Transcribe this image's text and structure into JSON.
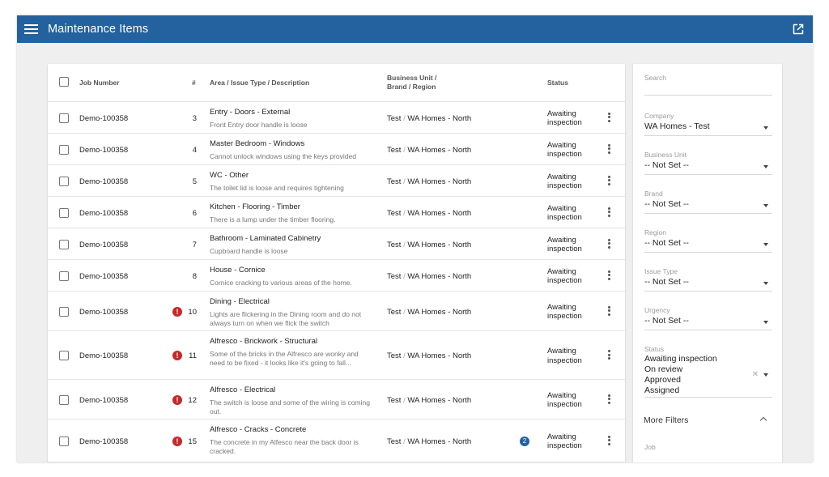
{
  "header": {
    "title": "Maintenance Items",
    "menu_icon": "menu-icon",
    "open_icon": "open-in-new-icon"
  },
  "colors": {
    "brand": "#23629e",
    "alert": "#c62828"
  },
  "table": {
    "columns": {
      "job": "Job Number",
      "num": "#",
      "desc": "Area / Issue Type / Description",
      "bu_line1": "Business Unit /",
      "bu_line2": "Brand / Region",
      "status": "Status"
    },
    "rows": [
      {
        "job": "Demo-100358",
        "num": "3",
        "alert": "",
        "area": "Entry - Doors - External",
        "desc": "Front Entry door handle is loose",
        "unit": "Test",
        "sep": "/",
        "region": "WA Homes - North",
        "count": "",
        "status1": "Awaiting",
        "status2": "inspection"
      },
      {
        "job": "Demo-100358",
        "num": "4",
        "alert": "",
        "area": "Master Bedroom - Windows",
        "desc": "Cannot unlock windows using the keys provided",
        "unit": "Test",
        "sep": "/",
        "region": "WA Homes - North",
        "count": "",
        "status1": "Awaiting",
        "status2": "inspection"
      },
      {
        "job": "Demo-100358",
        "num": "5",
        "alert": "",
        "area": "WC - Other",
        "desc": "The toilet lid is loose and requires tightening",
        "unit": "Test",
        "sep": "/",
        "region": "WA Homes - North",
        "count": "",
        "status1": "Awaiting",
        "status2": "inspection"
      },
      {
        "job": "Demo-100358",
        "num": "6",
        "alert": "",
        "area": "Kitchen - Flooring - Timber",
        "desc": "There is a lump under the timber flooring.",
        "unit": "Test",
        "sep": "/",
        "region": "WA Homes - North",
        "count": "",
        "status1": "Awaiting",
        "status2": "inspection"
      },
      {
        "job": "Demo-100358",
        "num": "7",
        "alert": "",
        "area": "Bathroom - Laminated Cabinetry",
        "desc": "Cupboard handle is loose",
        "unit": "Test",
        "sep": "/",
        "region": "WA Homes - North",
        "count": "",
        "status1": "Awaiting",
        "status2": "inspection"
      },
      {
        "job": "Demo-100358",
        "num": "8",
        "alert": "",
        "area": "House - Cornice",
        "desc": "Cornice cracking to various areas of the home.",
        "unit": "Test",
        "sep": "/",
        "region": "WA Homes - North",
        "count": "",
        "status1": "Awaiting",
        "status2": "inspection"
      },
      {
        "job": "Demo-100358",
        "num": "10",
        "alert": "!",
        "area": "Dining - Electrical",
        "desc": "Lights are flickering in the Dining room and do not always turn on when we flick the switch",
        "unit": "Test",
        "sep": "/",
        "region": "WA Homes - North",
        "count": "",
        "status1": "Awaiting",
        "status2": "inspection"
      },
      {
        "job": "Demo-100358",
        "num": "11",
        "alert": "!",
        "area": "Alfresco - Brickwork - Structural",
        "desc": "Some of the bricks in the Alfresco are wonky and need to be fixed - it looks like it's going to fall...",
        "unit": "Test",
        "sep": "/",
        "region": "WA Homes - North",
        "count": "",
        "status1": "Awaiting",
        "status2": "inspection"
      },
      {
        "job": "Demo-100358",
        "num": "12",
        "alert": "!",
        "area": "Alfresco - Electrical",
        "desc": "The switch is loose and some of the wiring is coming out.",
        "unit": "Test",
        "sep": "/",
        "region": "WA Homes - North",
        "count": "",
        "status1": "Awaiting",
        "status2": "inspection"
      },
      {
        "job": "Demo-100358",
        "num": "15",
        "alert": "!",
        "area": "Alfresco - Cracks - Concrete",
        "desc": "The concrete in my Alfesco near the back door is cracked.",
        "unit": "Test",
        "sep": "/",
        "region": "WA Homes - North",
        "count": "2",
        "status1": "Awaiting",
        "status2": "inspection"
      }
    ]
  },
  "filters": {
    "search_label": "Search",
    "company_label": "Company",
    "company_value": "WA Homes - Test",
    "business_unit_label": "Business Unit",
    "business_unit_value": "-- Not Set --",
    "brand_label": "Brand",
    "brand_value": "-- Not Set --",
    "region_label": "Region",
    "region_value": "-- Not Set --",
    "issue_type_label": "Issue Type",
    "issue_type_value": "-- Not Set --",
    "urgency_label": "Urgency",
    "urgency_value": "-- Not Set --",
    "status_label": "Status",
    "status_values": [
      "Awaiting inspection",
      "On review",
      "Approved",
      "Assigned"
    ],
    "clear_glyph": "✕",
    "more_filters": "More Filters",
    "job_label": "Job"
  }
}
